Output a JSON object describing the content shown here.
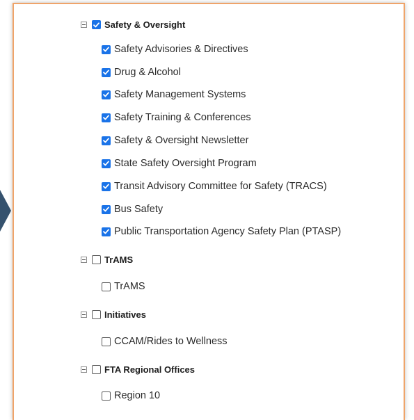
{
  "groups": [
    {
      "label": "Safety & Oversight",
      "checked": true,
      "items": [
        {
          "label": "Safety Advisories & Directives",
          "checked": true
        },
        {
          "label": "Drug & Alcohol",
          "checked": true
        },
        {
          "label": "Safety Management Systems",
          "checked": true
        },
        {
          "label": "Safety Training & Conferences",
          "checked": true
        },
        {
          "label": "Safety & Oversight Newsletter",
          "checked": true
        },
        {
          "label": "State Safety Oversight Program",
          "checked": true
        },
        {
          "label": "Transit Advisory Committee for Safety (TRACS)",
          "checked": true
        },
        {
          "label": "Bus Safety",
          "checked": true
        },
        {
          "label": "Public Transportation Agency Safety Plan (PTASP)",
          "checked": true
        }
      ]
    },
    {
      "label": "TrAMS",
      "checked": false,
      "items": [
        {
          "label": "TrAMS",
          "checked": false
        }
      ]
    },
    {
      "label": "Initiatives",
      "checked": false,
      "items": [
        {
          "label": "CCAM/Rides to Wellness",
          "checked": false
        }
      ]
    },
    {
      "label": "FTA Regional Offices",
      "checked": false,
      "items": [
        {
          "label": "Region 10",
          "checked": false
        }
      ]
    }
  ],
  "colors": {
    "checkbox_checked": "#1a73e8",
    "panel_border": "#efa46a",
    "side_arrow": "#35526e"
  }
}
